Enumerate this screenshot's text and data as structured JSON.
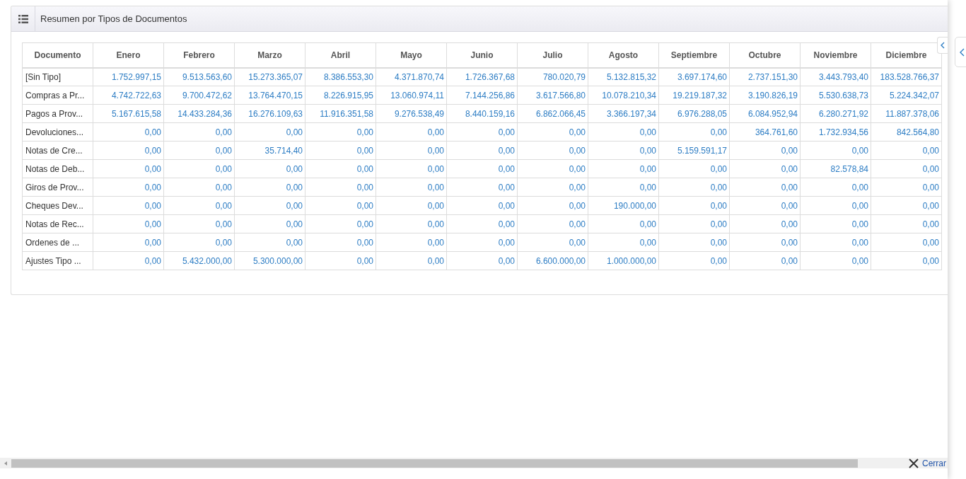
{
  "panel": {
    "title": "Resumen por Tipos de Documentos"
  },
  "table": {
    "columns": [
      "Documento",
      "Enero",
      "Febrero",
      "Marzo",
      "Abril",
      "Mayo",
      "Junio",
      "Julio",
      "Agosto",
      "Septiembre",
      "Octubre",
      "Noviembre",
      "Diciembre"
    ],
    "rows": [
      {
        "label": "[Sin Tipo]",
        "values": [
          "1.752.997,15",
          "9.513.563,60",
          "15.273.365,07",
          "8.386.553,30",
          "4.371.870,74",
          "1.726.367,68",
          "780.020,79",
          "5.132.815,32",
          "3.697.174,60",
          "2.737.151,30",
          "3.443.793,40",
          "183.528.766,37"
        ]
      },
      {
        "label": "Compras a Pr...",
        "values": [
          "4.742.722,63",
          "9.700.472,62",
          "13.764.470,15",
          "8.226.915,95",
          "13.060.974,11",
          "7.144.256,86",
          "3.617.566,80",
          "10.078.210,34",
          "19.219.187,32",
          "3.190.826,19",
          "5.530.638,73",
          "5.224.342,07"
        ]
      },
      {
        "label": "Pagos a Prov...",
        "values": [
          "5.167.615,58",
          "14.433.284,36",
          "16.276.109,63",
          "11.916.351,58",
          "9.276.538,49",
          "8.440.159,16",
          "6.862.066,45",
          "3.366.197,34",
          "6.976.288,05",
          "6.084.952,94",
          "6.280.271,92",
          "11.887.378,06"
        ]
      },
      {
        "label": "Devoluciones...",
        "values": [
          "0,00",
          "0,00",
          "0,00",
          "0,00",
          "0,00",
          "0,00",
          "0,00",
          "0,00",
          "0,00",
          "364.761,60",
          "1.732.934,56",
          "842.564,80"
        ]
      },
      {
        "label": "Notas de Cre...",
        "values": [
          "0,00",
          "0,00",
          "35.714,40",
          "0,00",
          "0,00",
          "0,00",
          "0,00",
          "0,00",
          "5.159.591,17",
          "0,00",
          "0,00",
          "0,00"
        ]
      },
      {
        "label": "Notas de Deb...",
        "values": [
          "0,00",
          "0,00",
          "0,00",
          "0,00",
          "0,00",
          "0,00",
          "0,00",
          "0,00",
          "0,00",
          "0,00",
          "82.578,84",
          "0,00"
        ]
      },
      {
        "label": "Giros de Prov...",
        "values": [
          "0,00",
          "0,00",
          "0,00",
          "0,00",
          "0,00",
          "0,00",
          "0,00",
          "0,00",
          "0,00",
          "0,00",
          "0,00",
          "0,00"
        ]
      },
      {
        "label": "Cheques Dev...",
        "values": [
          "0,00",
          "0,00",
          "0,00",
          "0,00",
          "0,00",
          "0,00",
          "0,00",
          "190.000,00",
          "0,00",
          "0,00",
          "0,00",
          "0,00"
        ]
      },
      {
        "label": "Notas de Rec...",
        "values": [
          "0,00",
          "0,00",
          "0,00",
          "0,00",
          "0,00",
          "0,00",
          "0,00",
          "0,00",
          "0,00",
          "0,00",
          "0,00",
          "0,00"
        ]
      },
      {
        "label": "Ordenes de ...",
        "values": [
          "0,00",
          "0,00",
          "0,00",
          "0,00",
          "0,00",
          "0,00",
          "0,00",
          "0,00",
          "0,00",
          "0,00",
          "0,00",
          "0,00"
        ]
      },
      {
        "label": "Ajustes Tipo ...",
        "values": [
          "0,00",
          "5.432.000,00",
          "5.300.000,00",
          "0,00",
          "0,00",
          "0,00",
          "6.600.000,00",
          "1.000.000,00",
          "0,00",
          "0,00",
          "0,00",
          "0,00"
        ]
      }
    ]
  },
  "footer": {
    "close_button": "Cerrar"
  }
}
